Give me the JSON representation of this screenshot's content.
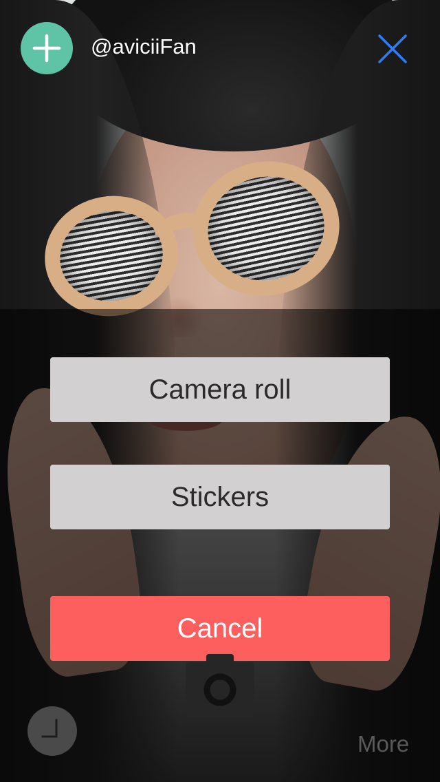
{
  "header": {
    "username": "@aviciiFan",
    "add_icon": "plus-icon",
    "close_icon": "close-icon"
  },
  "action_sheet": {
    "camera_roll_label": "Camera roll",
    "stickers_label": "Stickers",
    "cancel_label": "Cancel"
  },
  "toolbar": {
    "shutter_icon": "camera-icon",
    "history_icon": "clock-icon",
    "more_label": "More"
  },
  "colors": {
    "accent_green": "#5fc4a5",
    "close_blue": "#2f7cf6",
    "cancel_red": "#fc5f5d",
    "sheet_gray": "#d2d0d1"
  }
}
